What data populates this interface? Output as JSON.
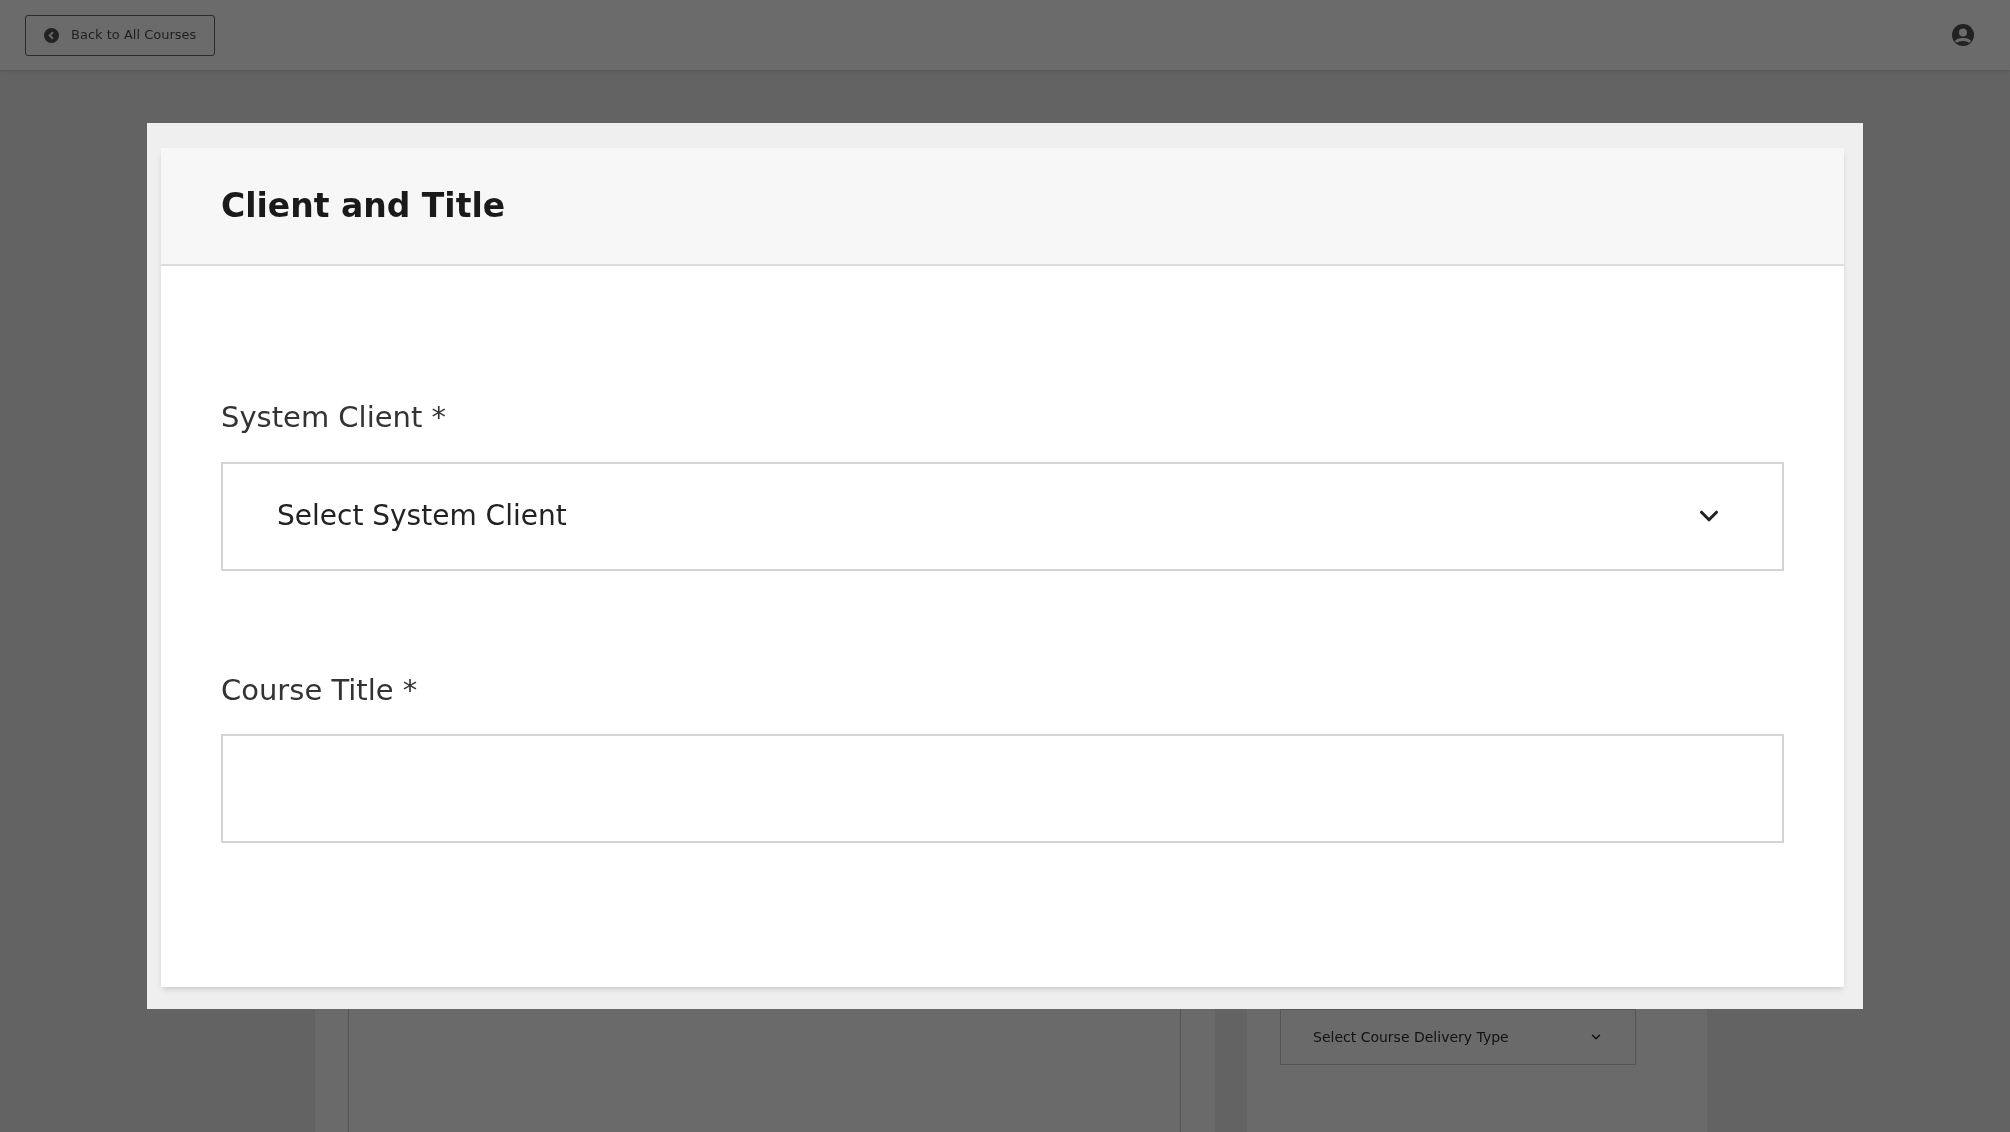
{
  "top_bar": {
    "back_button": "Back to All Courses"
  },
  "background": {
    "delivery_select": {
      "placeholder": "Select Course Delivery Type"
    }
  },
  "modal": {
    "title": "Client and Title",
    "fields": [
      {
        "kind": "select",
        "label": "System Client *",
        "placeholder": "Select System Client"
      },
      {
        "kind": "text",
        "label": "Course Title *"
      }
    ]
  }
}
